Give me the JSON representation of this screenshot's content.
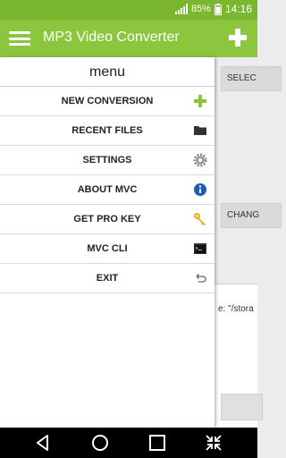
{
  "status": {
    "battery": "85%",
    "time": "14:16"
  },
  "app": {
    "title": "MP3 Video Converter"
  },
  "menu": {
    "title": "menu",
    "items": [
      {
        "label": "NEW CONVERSION",
        "icon": "plus-icon"
      },
      {
        "label": "RECENT FILES",
        "icon": "folder-icon"
      },
      {
        "label": "SETTINGS",
        "icon": "gear-icon"
      },
      {
        "label": "ABOUT MVC",
        "icon": "info-icon"
      },
      {
        "label": "GET PRO KEY",
        "icon": "key-icon"
      },
      {
        "label": "MVC CLI",
        "icon": "terminal-icon"
      },
      {
        "label": "EXIT",
        "icon": "undo-icon"
      }
    ]
  },
  "background": {
    "select_label": "SELEC",
    "change_label": "CHANG",
    "path_text": "e: \"/stora"
  },
  "colors": {
    "status_bar": "#7ab62f",
    "app_bar": "#8cc63f",
    "accent_green": "#8cc63f"
  }
}
